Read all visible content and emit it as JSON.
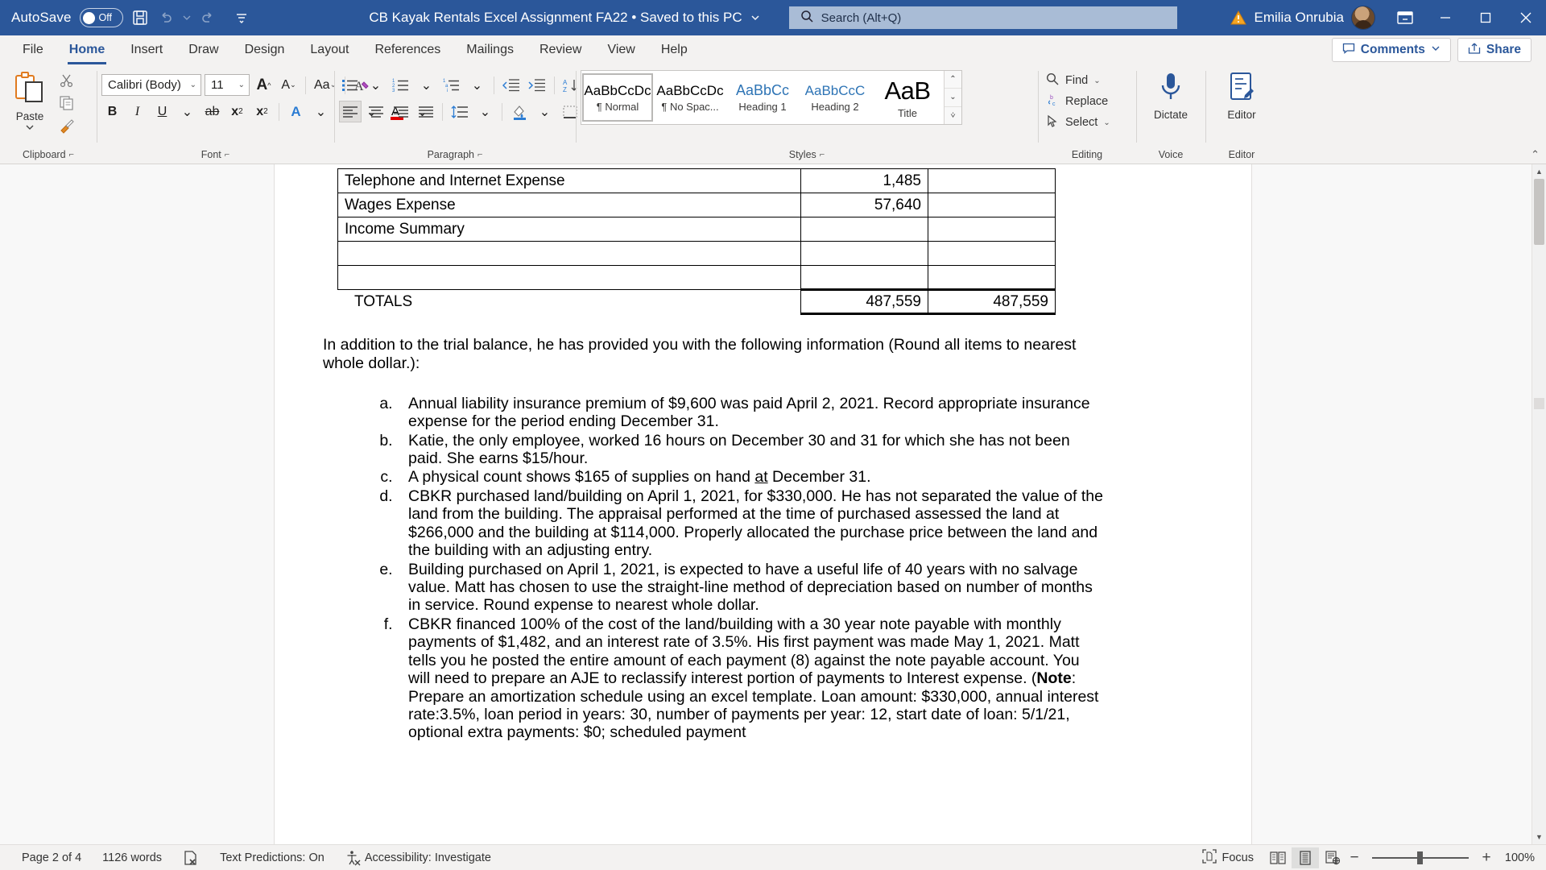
{
  "titlebar": {
    "autosave_label": "AutoSave",
    "autosave_state": "Off",
    "save_icon": "save-icon",
    "undo_icon": "undo-icon",
    "redo_icon": "redo-icon",
    "customize_icon": "customize-quick-access-icon",
    "document_title": "CB Kayak Rentals Excel Assignment FA22 • Saved to this PC",
    "title_chevron": "chevron-down-icon",
    "search_placeholder": "Search (Alt+Q)",
    "search_icon": "search-icon",
    "account_warning_icon": "warning-icon",
    "account_name": "Emilia Onrubia",
    "ribbon_display_icon": "ribbon-display-options-icon",
    "minimize_icon": "minimize-icon",
    "restore_icon": "restore-icon",
    "close_icon": "close-icon",
    "bg_color": "#2b579a"
  },
  "tabs": [
    {
      "label": "File",
      "active": false
    },
    {
      "label": "Home",
      "active": true
    },
    {
      "label": "Insert",
      "active": false
    },
    {
      "label": "Draw",
      "active": false
    },
    {
      "label": "Design",
      "active": false
    },
    {
      "label": "Layout",
      "active": false
    },
    {
      "label": "References",
      "active": false
    },
    {
      "label": "Mailings",
      "active": false
    },
    {
      "label": "Review",
      "active": false
    },
    {
      "label": "View",
      "active": false
    },
    {
      "label": "Help",
      "active": false
    }
  ],
  "tabs_right": {
    "comments_label": "Comments",
    "comments_icon": "comment-icon",
    "comments_chevron": "chevron-down-icon",
    "share_label": "Share",
    "share_icon": "share-icon",
    "accent_color": "#2b579a"
  },
  "ribbon": {
    "clipboard": {
      "group_label": "Clipboard",
      "paste_label": "Paste",
      "paste_icon": "paste-icon",
      "paste_chevron": "chevron-down-icon",
      "cut_icon": "scissors-icon",
      "copy_icon": "copy-icon",
      "format_painter_icon": "format-painter-icon",
      "dialog_launcher": "dialog-launcher-icon"
    },
    "font": {
      "group_label": "Font",
      "font_name": "Calibri (Body)",
      "font_size": "11",
      "grow_font_icon": "grow-font-icon",
      "shrink_font_icon": "shrink-font-icon",
      "change_case_icon": "change-case-icon",
      "clear_formatting_icon": "clear-formatting-icon",
      "bold_label": "B",
      "italic_label": "I",
      "underline_label": "U",
      "strikethrough_label": "ab",
      "subscript_label": "x",
      "superscript_label": "x",
      "text_effects_icon": "text-effects-icon",
      "highlight_icon": "text-highlight-icon",
      "font_color_icon": "font-color-icon",
      "dialog_launcher": "dialog-launcher-icon"
    },
    "paragraph": {
      "group_label": "Paragraph",
      "bullets_icon": "bullet-list-icon",
      "numbering_icon": "numbered-list-icon",
      "multilevel_icon": "multilevel-list-icon",
      "decrease_indent_icon": "decrease-indent-icon",
      "increase_indent_icon": "increase-indent-icon",
      "sort_icon": "sort-icon",
      "show_marks_icon": "paragraph-marks-icon",
      "align_left_icon": "align-left-icon",
      "align_center_icon": "align-center-icon",
      "align_right_icon": "align-right-icon",
      "justify_icon": "justify-icon",
      "line_spacing_icon": "line-spacing-icon",
      "shading_icon": "shading-icon",
      "borders_icon": "borders-icon",
      "dialog_launcher": "dialog-launcher-icon"
    },
    "styles": {
      "group_label": "Styles",
      "dialog_launcher": "dialog-launcher-icon",
      "scroll_up_icon": "chevron-up-icon",
      "scroll_down_icon": "chevron-down-icon",
      "more_icon": "styles-more-icon",
      "items": [
        {
          "preview": "AaBbCcDc",
          "name": "¶ Normal",
          "selected": true,
          "kind": "normal"
        },
        {
          "preview": "AaBbCcDc",
          "name": "¶ No Spac...",
          "selected": false,
          "kind": "normal"
        },
        {
          "preview": "AaBbCc",
          "name": "Heading 1",
          "selected": false,
          "kind": "h1"
        },
        {
          "preview": "AaBbCcC",
          "name": "Heading 2",
          "selected": false,
          "kind": "h2"
        },
        {
          "preview": "AaB",
          "name": "Title",
          "selected": false,
          "kind": "title"
        }
      ]
    },
    "editing": {
      "group_label": "Editing",
      "find_label": "Find",
      "find_icon": "search-icon",
      "find_chevron": "chevron-down-icon",
      "replace_label": "Replace",
      "replace_icon": "replace-icon",
      "select_label": "Select",
      "select_icon": "cursor-select-icon",
      "select_chevron": "chevron-down-icon"
    },
    "voice": {
      "group_label": "Voice",
      "dictate_label": "Dictate",
      "dictate_icon": "microphone-icon"
    },
    "editor": {
      "group_label": "Editor",
      "editor_label": "Editor",
      "editor_icon": "editor-pen-icon"
    },
    "collapse_icon": "collapse-ribbon-icon"
  },
  "document": {
    "trial_balance_table": {
      "rows": [
        {
          "account": "Telephone and Internet Expense",
          "debit": "1,485",
          "credit": ""
        },
        {
          "account": "Wages Expense",
          "debit": "57,640",
          "credit": ""
        },
        {
          "account": "Income Summary",
          "debit": "",
          "credit": ""
        },
        {
          "account": "",
          "debit": "",
          "credit": ""
        },
        {
          "account": "",
          "debit": "",
          "credit": ""
        }
      ],
      "totals": {
        "account": "TOTALS",
        "debit": "487,559",
        "credit": "487,559"
      }
    },
    "intro_paragraph": "In addition to the trial balance, he has provided you with the following information (Round all items to nearest whole dollar.):",
    "list_items": [
      "Annual liability insurance premium of $9,600 was paid April 2, 2021. Record appropriate insurance expense for the period ending December 31.",
      "Katie, the only employee, worked 16 hours on December 30 and 31 for which she has not been paid. She earns $15/hour.",
      "A physical count shows $165 of supplies on hand at December 31.",
      "CBKR purchased land/building on April 1, 2021, for $330,000. He has not separated the value of the land from the building. The appraisal performed at the time of purchased assessed the land at $266,000 and the building at $114,000. Properly allocated the purchase price between the land and the building with an adjusting entry.",
      "Building purchased on April 1, 2021, is expected to have a useful life of 40 years with no salvage value. Matt has chosen to use the straight-line method of depreciation based on number of months in service. Round expense to nearest whole dollar.",
      "CBKR financed 100% of the cost of the land/building with a 30 year note payable with monthly payments of $1,482, and an interest rate of 3.5%. His first payment was made May 1, 2021. Matt tells you he posted the entire amount of each payment (8) against the note payable account. You will need to prepare an AJE to reclassify interest portion of payments to Interest expense. (Note:  Prepare an amortization schedule using an excel template. Loan amount: $330,000, annual interest rate:3.5%, loan period in years: 30, number of payments per year: 12, start date of loan: 5/1/21, optional extra payments: $0; scheduled payment"
    ],
    "list_item_c_underlined_word": "at",
    "list_item_f_bold_word": "Note"
  },
  "scrollbar": {
    "up_icon": "scroll-up-icon",
    "down_icon": "scroll-down-icon",
    "split_icon": "split-window-icon"
  },
  "statusbar": {
    "page_info": "Page 2 of 4",
    "word_count": "1126 words",
    "proofing_icon": "proofing-errors-icon",
    "text_predictions": "Text Predictions: On",
    "accessibility_icon": "accessibility-icon",
    "accessibility": "Accessibility: Investigate",
    "focus_label": "Focus",
    "focus_icon": "focus-mode-icon",
    "read_mode_icon": "read-mode-icon",
    "print_layout_icon": "print-layout-icon",
    "web_layout_icon": "web-layout-icon",
    "zoom_out_label": "−",
    "zoom_in_label": "+",
    "zoom_level": "100%"
  }
}
